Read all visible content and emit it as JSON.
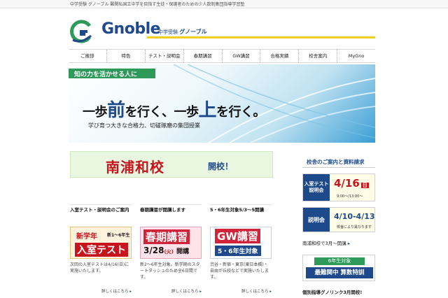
{
  "topbar": {
    "text": "中学受験 グノーブル 難関私国立中学を目指す生徒・保護者のための少人数制集団指導学習塾"
  },
  "logo": {
    "name": "Gnoble",
    "sub_small": "中学受験",
    "sub_big": "グノーブル"
  },
  "nav": [
    "ご挨拶",
    "特色",
    "テスト・説明会",
    "春期講習",
    "GW講習",
    "合格実績",
    "校舎案内",
    "MyGno"
  ],
  "hero": {
    "band": "知の力を活かせる人に",
    "catch_1": "一歩",
    "catch_2": "前",
    "catch_3": "を行く、一歩",
    "catch_4": "上",
    "catch_5": "を行く。",
    "sub": "学び育つ大きな合格力、切磋琢磨の集団授業"
  },
  "banner": {
    "name": "南浦和校",
    "open": "開校！"
  },
  "news": [
    {
      "title": "入室テスト・説明会のご案内",
      "img_line1": "新学年",
      "img_line1_small": "新1〜6年生",
      "img_line2": "入室テスト",
      "body": "次回の入室テストは4/16(日)に実施いたします。",
      "more": "詳しくはこちら"
    },
    {
      "title": "春期講習が開講します",
      "img_line1": "春期講習",
      "img_line2_date": "3/28",
      "img_line2_day": "(火)",
      "img_line2_text": "開講",
      "body": "新2〜6年生対象。新学期のスタートダッシュのため全6日間です。",
      "more": "詳しくはこちら"
    },
    {
      "title": "5・6年生対象5/3〜5開講",
      "img_line1": "GW講習",
      "img_line2": "5・6年生対象",
      "body": "渋谷・新宿・東京(東日本橋)・自由が丘校などで実施いたします。",
      "more": "詳しくはこちら"
    }
  ],
  "sidebar": {
    "head": "校舎のご案内と資料請求",
    "box1": {
      "label": "入室テスト説明会",
      "date": "4/16",
      "day": "日",
      "time": "9:00〜/13:00〜"
    },
    "box2": {
      "label": "説明会",
      "date": "4/10-4/13",
      "note": "校舎により異なります"
    },
    "link": "南浦和校で3月〜開講",
    "box3": {
      "ribbon": "6年生対象",
      "main": "最難関中 算数特訓"
    },
    "foot": "個別指導グノリンク3月開校!"
  },
  "colors": {
    "navy": "#1e4a8c",
    "green": "#2e9a5a",
    "red": "#c6151d",
    "yellow": "#f1cf1f"
  }
}
